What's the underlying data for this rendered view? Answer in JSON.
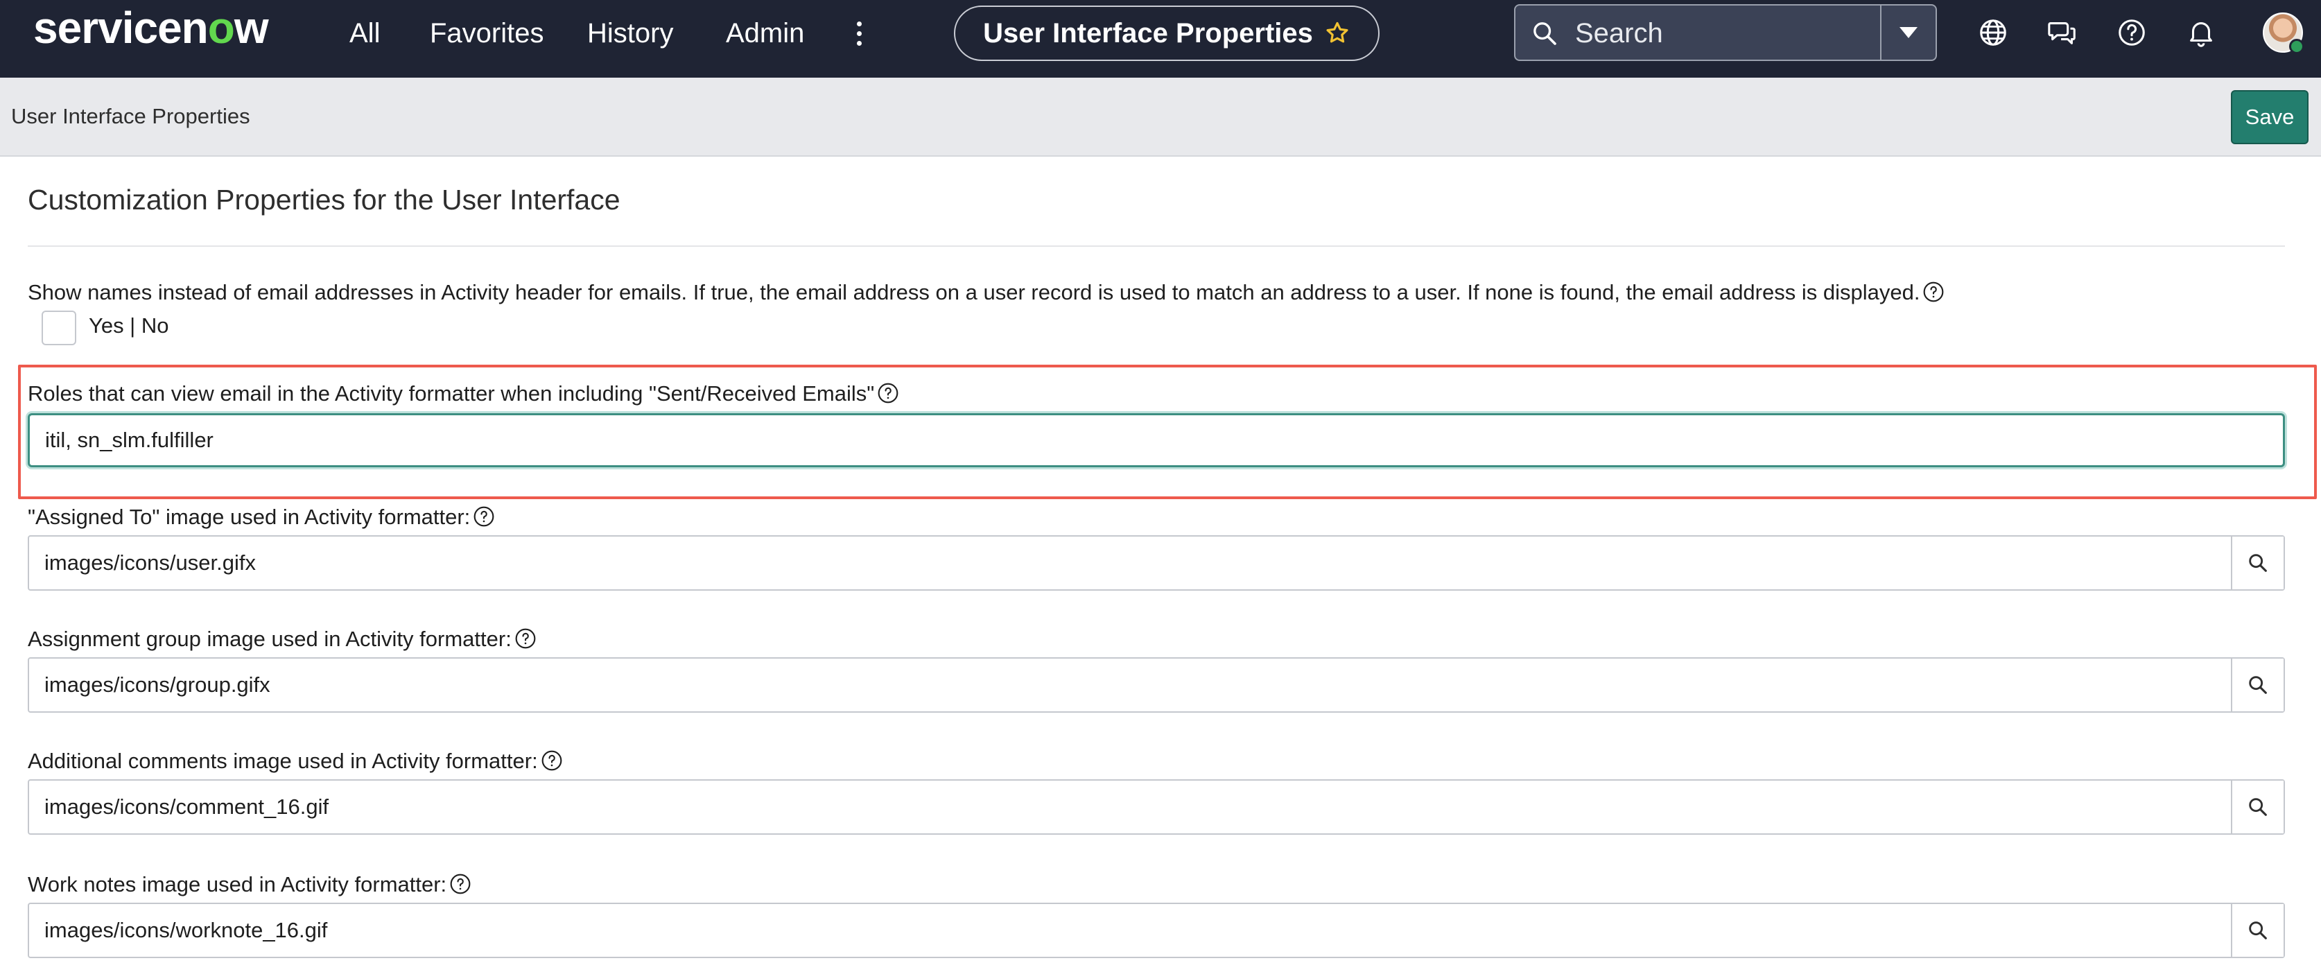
{
  "topbar": {
    "logo_text": "servicenow",
    "nav": {
      "all": "All",
      "favorites": "Favorites",
      "history": "History",
      "admin": "Admin"
    },
    "current_page": "User Interface Properties",
    "search_placeholder": "Search",
    "icons": [
      "globe-icon",
      "chat-icon",
      "help-icon",
      "bell-icon"
    ]
  },
  "subheader": {
    "title": "User Interface Properties",
    "save_label": "Save"
  },
  "main": {
    "section_title": "Customization Properties for the User Interface",
    "properties": {
      "show_names": {
        "label": "Show names instead of email addresses in Activity header for emails. If true, the email address on a user record is used to match an address to a user. If none is found, the email address is displayed.",
        "option_hint": "Yes | No"
      },
      "roles_view_email": {
        "label": "Roles that can view email in the Activity formatter when including \"Sent/Received Emails\"",
        "value": "itil, sn_slm.fulfiller"
      },
      "assigned_to_image": {
        "label": "\"Assigned To\" image used in Activity formatter:",
        "value": "images/icons/user.gifx"
      },
      "assignment_group_image": {
        "label": "Assignment group image used in Activity formatter:",
        "value": "images/icons/group.gifx"
      },
      "additional_comments_image": {
        "label": "Additional comments image used in Activity formatter:",
        "value": "images/icons/comment_16.gif"
      },
      "work_notes_image": {
        "label": "Work notes image used in Activity formatter:",
        "value": "images/icons/worknote_16.gif"
      }
    }
  },
  "colors": {
    "topbar_bg": "#1f2434",
    "save_button": "#237e6e",
    "highlight_border": "#ee5a4d",
    "focus_border": "#3d8f82"
  }
}
